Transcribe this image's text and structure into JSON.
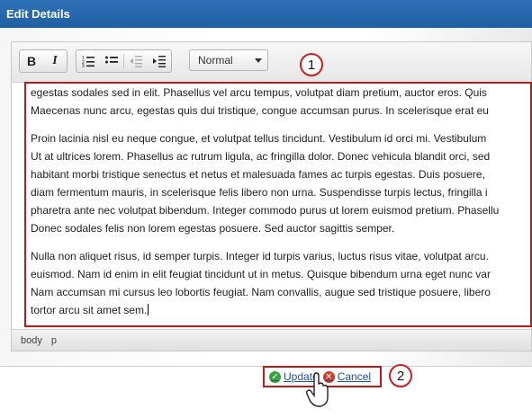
{
  "window": {
    "title": "Edit Details"
  },
  "toolbar": {
    "bold": "B",
    "italic": "I",
    "ordered_list": "numbered-list-icon",
    "bullet_list": "bullet-list-icon",
    "outdent": "outdent-icon",
    "indent": "indent-icon",
    "format_value": "Normal"
  },
  "callouts": {
    "one": "1",
    "two": "2"
  },
  "content": {
    "p1_l1": "egestas sodales sed in elit. Phasellus vel arcu tempus, volutpat diam pretium, auctor eros. Quis",
    "p1_l2": "Maecenas nunc arcu, egestas quis dui tristique, congue accumsan purus. In scelerisque erat eu",
    "p2_l1": "Proin lacinia nisl eu neque congue, et volutpat tellus tincidunt. Vestibulum id orci mi. Vestibulum",
    "p2_l2": "Ut at ultrices lorem. Phasellus ac rutrum ligula, ac fringilla dolor. Donec vehicula blandit orci, sed",
    "p2_l3": "habitant morbi tristique senectus et netus et malesuada fames ac turpis egestas. Duis posuere,",
    "p2_l4": "diam fermentum mauris, in scelerisque felis libero non urna. Suspendisse turpis lectus, fringilla i",
    "p2_l5": "pharetra ante nec volutpat bibendum. Integer commodo purus ut lorem euismod pretium. Phasellu",
    "p2_l6": "Donec sodales felis non lorem egestas posuere. Sed auctor sagittis semper.",
    "p3_l1": "Nulla non aliquet risus, id semper turpis. Integer id turpis varius, luctus risus vitae, volutpat arcu.",
    "p3_l2": "euismod. Nam id enim in elit feugiat tincidunt ut in metus. Quisque bibendum urna eget nunc var",
    "p3_l3": "Nam accumsan mi cursus leo lobortis feugiat. Nam convallis, augue sed tristique posuere, libero",
    "p3_l4": "tortor arcu sit amet sem."
  },
  "statusbar": {
    "path1": "body",
    "path2": "p"
  },
  "actions": {
    "update": "Update",
    "cancel": "Cancel"
  },
  "colors": {
    "titlebar": "#1f5fa3",
    "highlight": "#b51d1d",
    "link": "#1a4fa3"
  }
}
